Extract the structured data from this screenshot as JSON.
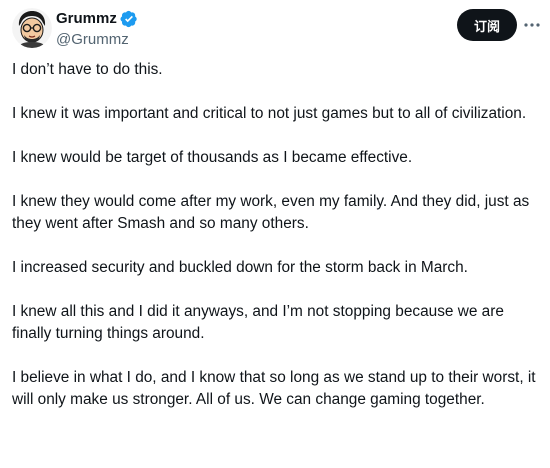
{
  "author": {
    "display_name": "Grummz",
    "handle": "@Grummz",
    "verified": true
  },
  "header": {
    "subscribe_label": "订阅",
    "more_icon": "more-horizontal-icon"
  },
  "colors": {
    "verified_blue": "#1d9bf0",
    "text_primary": "#0f1419",
    "text_secondary": "#536471",
    "button_bg": "#0f1419"
  },
  "tweet": {
    "paragraphs": [
      "I don’t have to do this.",
      "I knew it was important and critical to not just games but to all of civilization.",
      "I knew would be target of thousands as I became effective.",
      "I knew they would come after my work, even my family. And they did, just as they went after Smash and so many others.",
      "I increased security and buckled down for the storm back in March.",
      "I knew all this and I did it anyways, and I’m not stopping because we are finally turning things around.",
      "I believe in what I do, and I know that so long as we stand up to their worst, it will only make us stronger. All of us. We can change gaming together."
    ]
  }
}
